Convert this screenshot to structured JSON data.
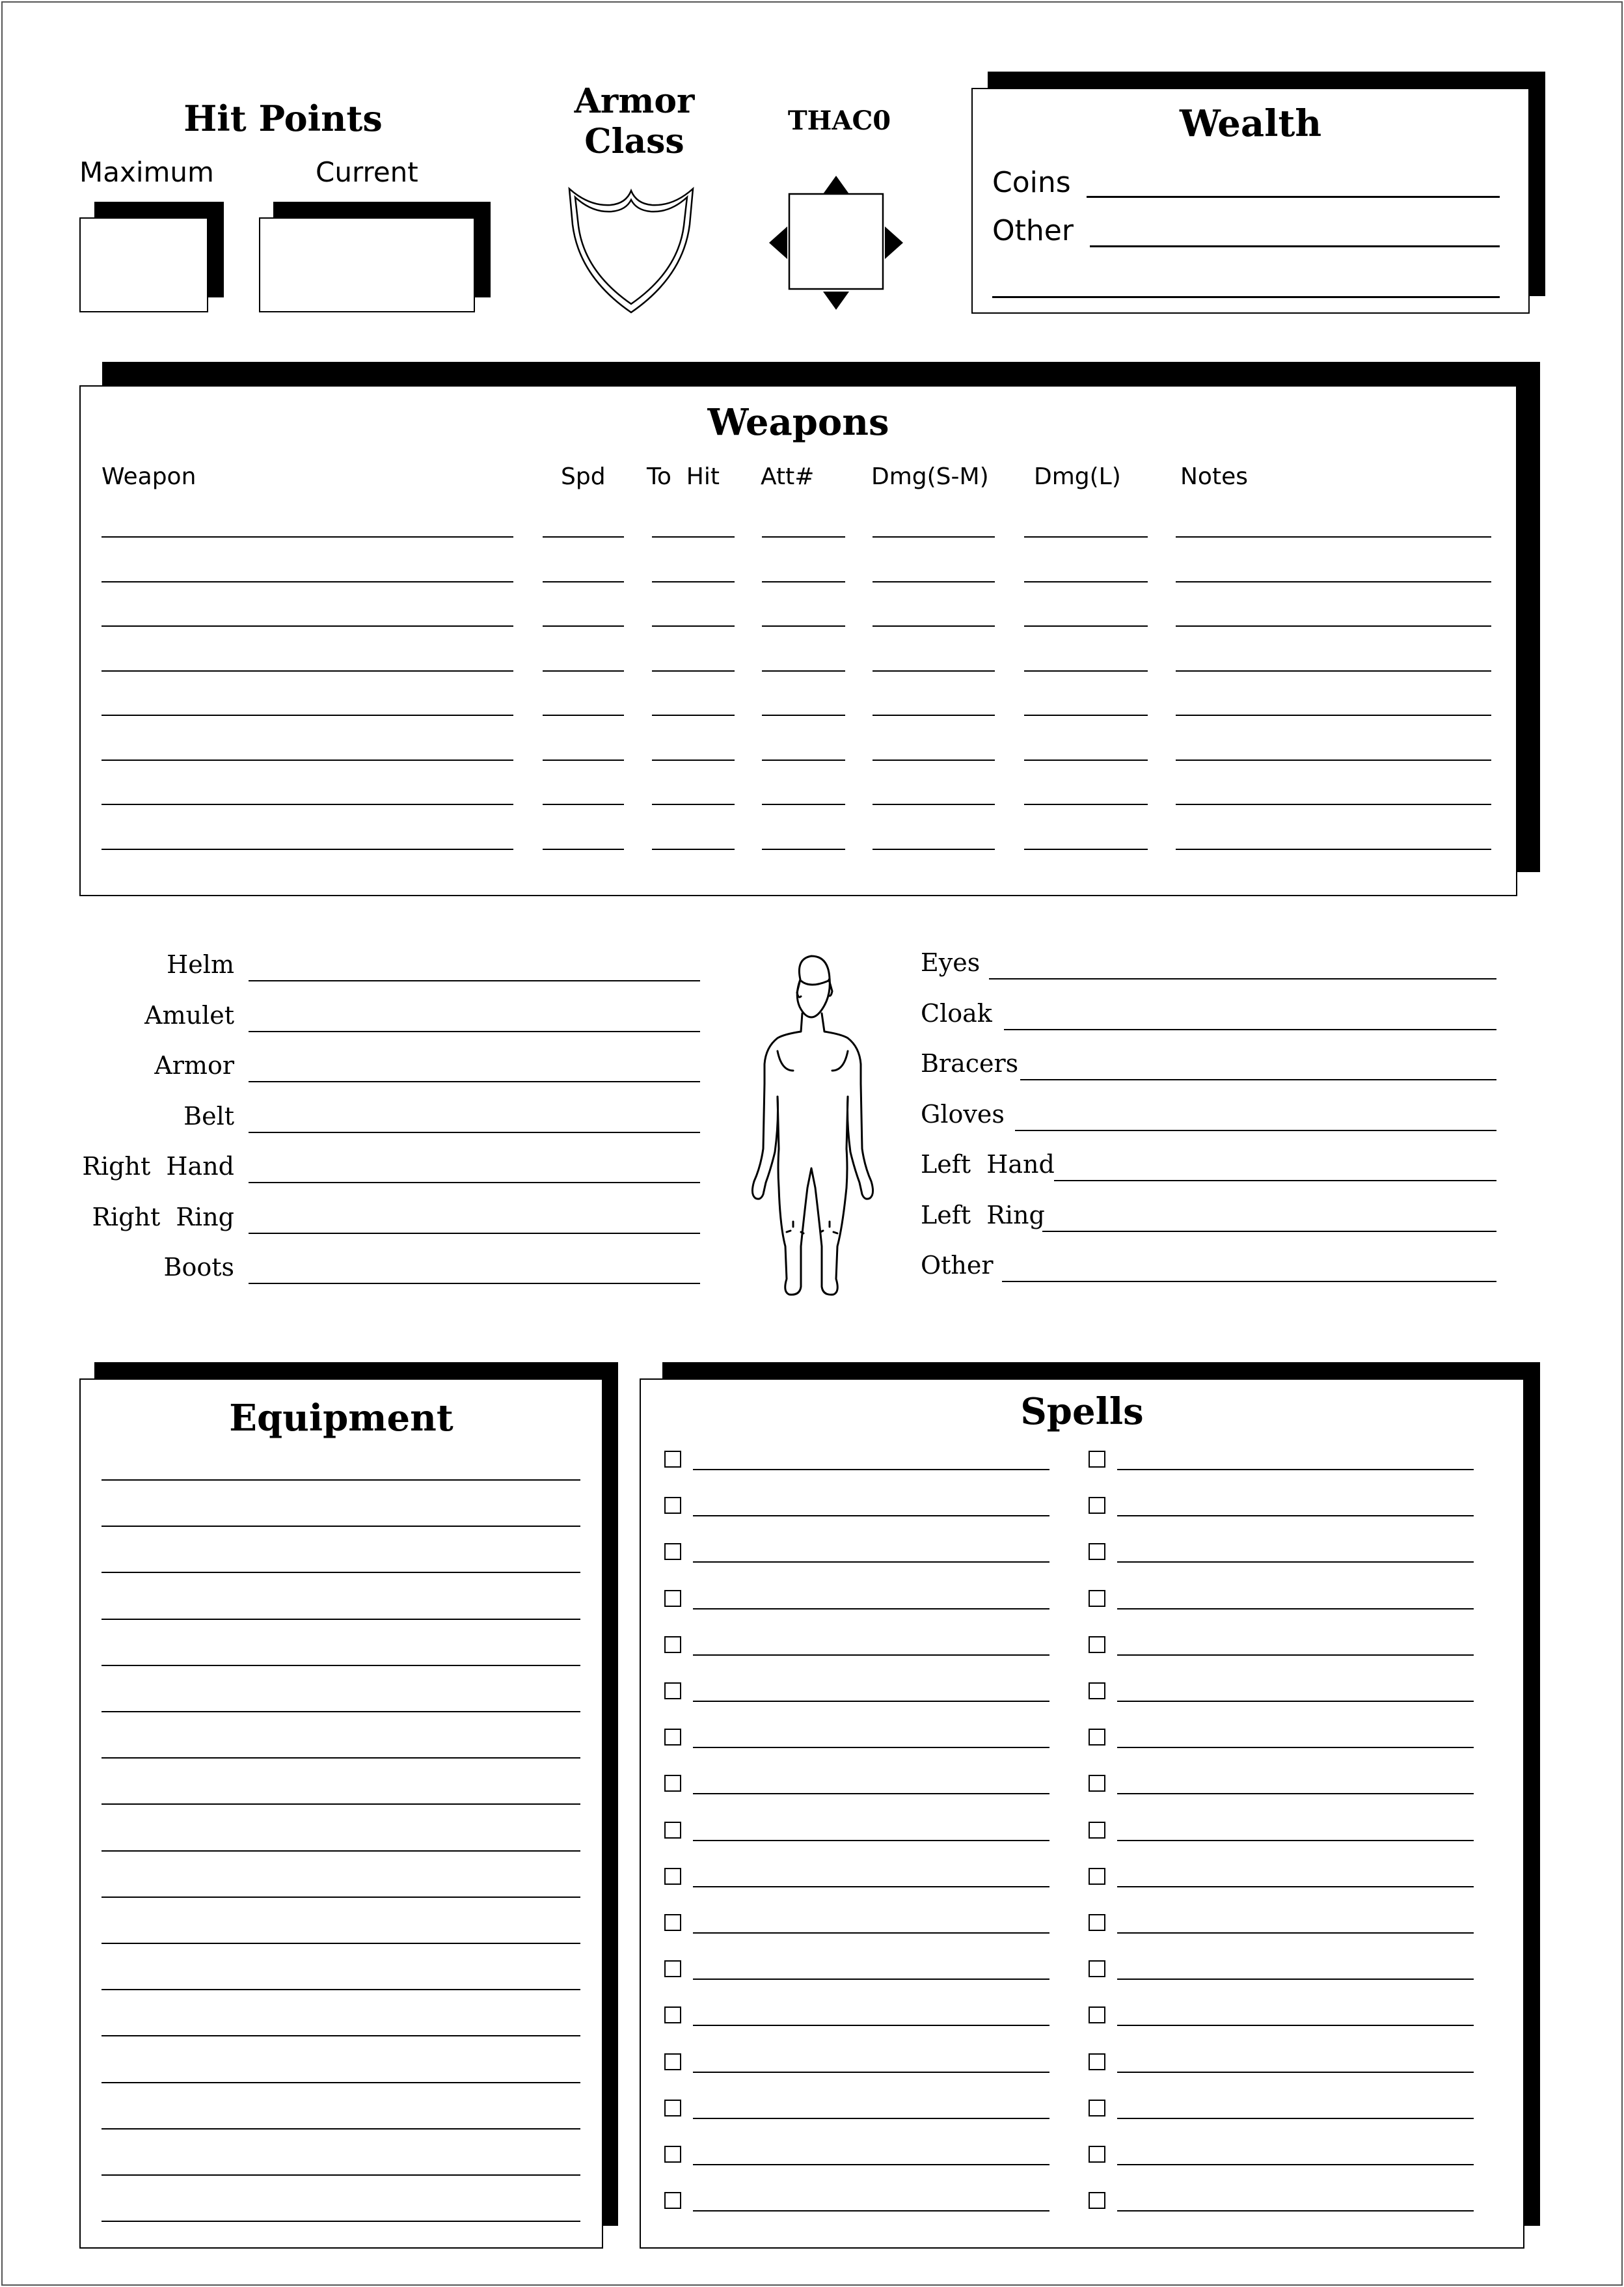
{
  "hit_points": {
    "title": "Hit Points",
    "maximum_label": "Maximum",
    "current_label": "Current",
    "maximum_value": "",
    "current_value": ""
  },
  "armor_class": {
    "title_line1": "Armor",
    "title_line2": "Class",
    "value": "",
    "icon": "shield-icon"
  },
  "thac0": {
    "title": "THAC0",
    "value": "",
    "icon": "diamond-arrows-icon"
  },
  "wealth": {
    "title": "Wealth",
    "coins_label": "Coins",
    "other_label": "Other",
    "coins_value": "",
    "other_value": "",
    "extra_value": ""
  },
  "weapons": {
    "title": "Weapons",
    "columns": [
      "Weapon",
      "Spd",
      "To  Hit",
      "Att#",
      "Dmg(S-M)",
      "Dmg(L)",
      "Notes"
    ],
    "rows": [
      [
        "",
        "",
        "",
        "",
        "",
        "",
        ""
      ],
      [
        "",
        "",
        "",
        "",
        "",
        "",
        ""
      ],
      [
        "",
        "",
        "",
        "",
        "",
        "",
        ""
      ],
      [
        "",
        "",
        "",
        "",
        "",
        "",
        ""
      ],
      [
        "",
        "",
        "",
        "",
        "",
        "",
        ""
      ],
      [
        "",
        "",
        "",
        "",
        "",
        "",
        ""
      ],
      [
        "",
        "",
        "",
        "",
        "",
        "",
        ""
      ],
      [
        "",
        "",
        "",
        "",
        "",
        "",
        ""
      ]
    ]
  },
  "slots": {
    "figure_icon": "human-figure-icon",
    "left": [
      {
        "label": "Helm",
        "value": ""
      },
      {
        "label": "Amulet",
        "value": ""
      },
      {
        "label": "Armor",
        "value": ""
      },
      {
        "label": "Belt",
        "value": ""
      },
      {
        "label": "Right  Hand",
        "value": ""
      },
      {
        "label": "Right  Ring",
        "value": ""
      },
      {
        "label": "Boots",
        "value": ""
      }
    ],
    "right": [
      {
        "label": "Eyes",
        "value": ""
      },
      {
        "label": "Cloak",
        "value": ""
      },
      {
        "label": "Bracers",
        "value": ""
      },
      {
        "label": "Gloves",
        "value": ""
      },
      {
        "label": "Left  Hand",
        "value": ""
      },
      {
        "label": "Left  Ring",
        "value": ""
      },
      {
        "label": "Other",
        "value": ""
      }
    ]
  },
  "equipment": {
    "title": "Equipment",
    "lines": [
      "",
      "",
      "",
      "",
      "",
      "",
      "",
      "",
      "",
      "",
      "",
      "",
      "",
      "",
      "",
      "",
      ""
    ]
  },
  "spells": {
    "title": "Spells",
    "left_column": [
      {
        "checked": false,
        "name": ""
      },
      {
        "checked": false,
        "name": ""
      },
      {
        "checked": false,
        "name": ""
      },
      {
        "checked": false,
        "name": ""
      },
      {
        "checked": false,
        "name": ""
      },
      {
        "checked": false,
        "name": ""
      },
      {
        "checked": false,
        "name": ""
      },
      {
        "checked": false,
        "name": ""
      },
      {
        "checked": false,
        "name": ""
      },
      {
        "checked": false,
        "name": ""
      },
      {
        "checked": false,
        "name": ""
      },
      {
        "checked": false,
        "name": ""
      },
      {
        "checked": false,
        "name": ""
      },
      {
        "checked": false,
        "name": ""
      },
      {
        "checked": false,
        "name": ""
      },
      {
        "checked": false,
        "name": ""
      },
      {
        "checked": false,
        "name": ""
      }
    ],
    "right_column": [
      {
        "checked": false,
        "name": ""
      },
      {
        "checked": false,
        "name": ""
      },
      {
        "checked": false,
        "name": ""
      },
      {
        "checked": false,
        "name": ""
      },
      {
        "checked": false,
        "name": ""
      },
      {
        "checked": false,
        "name": ""
      },
      {
        "checked": false,
        "name": ""
      },
      {
        "checked": false,
        "name": ""
      },
      {
        "checked": false,
        "name": ""
      },
      {
        "checked": false,
        "name": ""
      },
      {
        "checked": false,
        "name": ""
      },
      {
        "checked": false,
        "name": ""
      },
      {
        "checked": false,
        "name": ""
      },
      {
        "checked": false,
        "name": ""
      },
      {
        "checked": false,
        "name": ""
      },
      {
        "checked": false,
        "name": ""
      },
      {
        "checked": false,
        "name": ""
      }
    ]
  }
}
